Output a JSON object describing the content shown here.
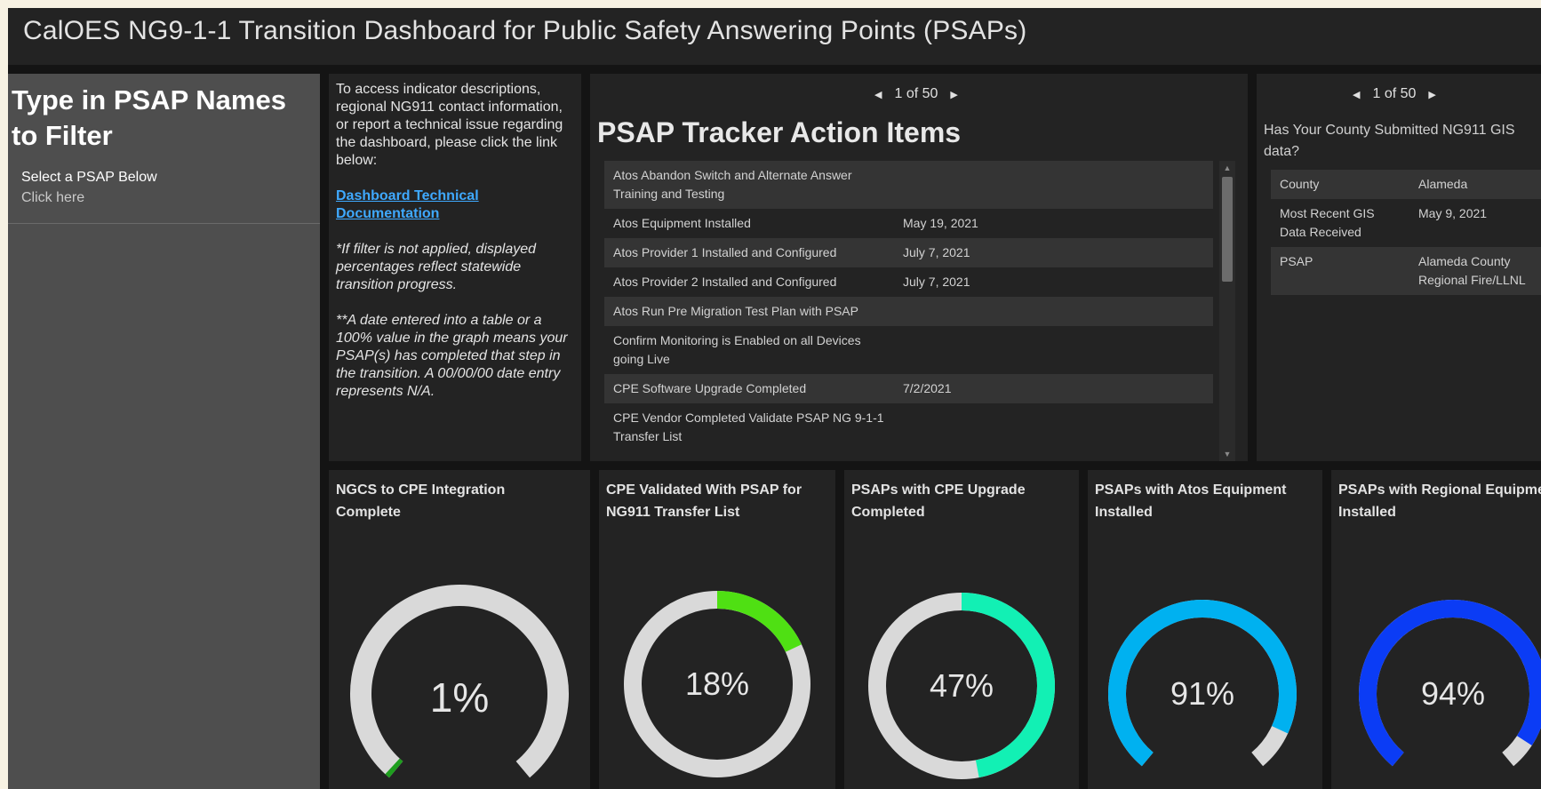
{
  "header": {
    "title": "CalOES NG9-1-1 Transition Dashboard for Public Safety Answering Points (PSAPs)"
  },
  "filter": {
    "title": "Type in PSAP Names to Filter",
    "select_label": "Select a PSAP Below",
    "select_hint": "Click here"
  },
  "info": {
    "intro": "To access indicator descriptions, regional NG911 contact information, or report a technical issue regarding the dashboard, please click the link below:",
    "link": "Dashboard Technical Documentation",
    "note1": "*If filter is not applied, displayed percentages reflect statewide transition progress.",
    "note2": "**A date entered into a table or a 100% value in the graph means your PSAP(s) has completed that step in the transition. A 00/00/00 date entry represents N/A."
  },
  "tracker": {
    "pager": "1 of 50",
    "title": "PSAP Tracker Action Items",
    "rows": [
      {
        "item": "Atos Abandon Switch and Alternate Answer Training and Testing",
        "date": ""
      },
      {
        "item": "Atos Equipment Installed",
        "date": "May 19, 2021"
      },
      {
        "item": "Atos Provider 1 Installed and Configured",
        "date": "July 7, 2021"
      },
      {
        "item": "Atos Provider 2 Installed and Configured",
        "date": "July 7, 2021"
      },
      {
        "item": "Atos Run Pre Migration Test Plan with PSAP",
        "date": ""
      },
      {
        "item": "Confirm Monitoring is Enabled on all Devices going Live",
        "date": ""
      },
      {
        "item": "CPE Software Upgrade Completed",
        "date": "7/2/2021"
      },
      {
        "item": "CPE Vendor Completed Validate PSAP NG 9-1-1 Transfer List",
        "date": ""
      }
    ]
  },
  "gis": {
    "pager": "1 of 50",
    "question": "Has Your County Submitted NG911 GIS data?",
    "rows": [
      {
        "label": "County",
        "value": "Alameda"
      },
      {
        "label": "Most Recent GIS Data Received",
        "value": "May 9, 2021"
      },
      {
        "label": "PSAP",
        "value": "Alameda County Regional Fire/LLNL"
      }
    ]
  },
  "gauges": [
    {
      "title": "NGCS to CPE Integration Complete",
      "value": 1,
      "label": "1%",
      "style": "arc",
      "color": "#1e9e1e"
    },
    {
      "title": "CPE Validated With PSAP for NG911 Transfer List",
      "value": 18,
      "label": "18%",
      "style": "ring",
      "color": "#4fe013"
    },
    {
      "title": "PSAPs with CPE Upgrade Completed",
      "value": 47,
      "label": "47%",
      "style": "ring",
      "color": "#12f0b4"
    },
    {
      "title": "PSAPs with Atos Equipment Installed",
      "value": 91,
      "label": "91%",
      "style": "arc",
      "color": "#00b1f0"
    },
    {
      "title": "PSAPs with Regional Equipment Installed",
      "value": 94,
      "label": "94%",
      "style": "arc",
      "color": "#0b3cf5"
    }
  ]
}
